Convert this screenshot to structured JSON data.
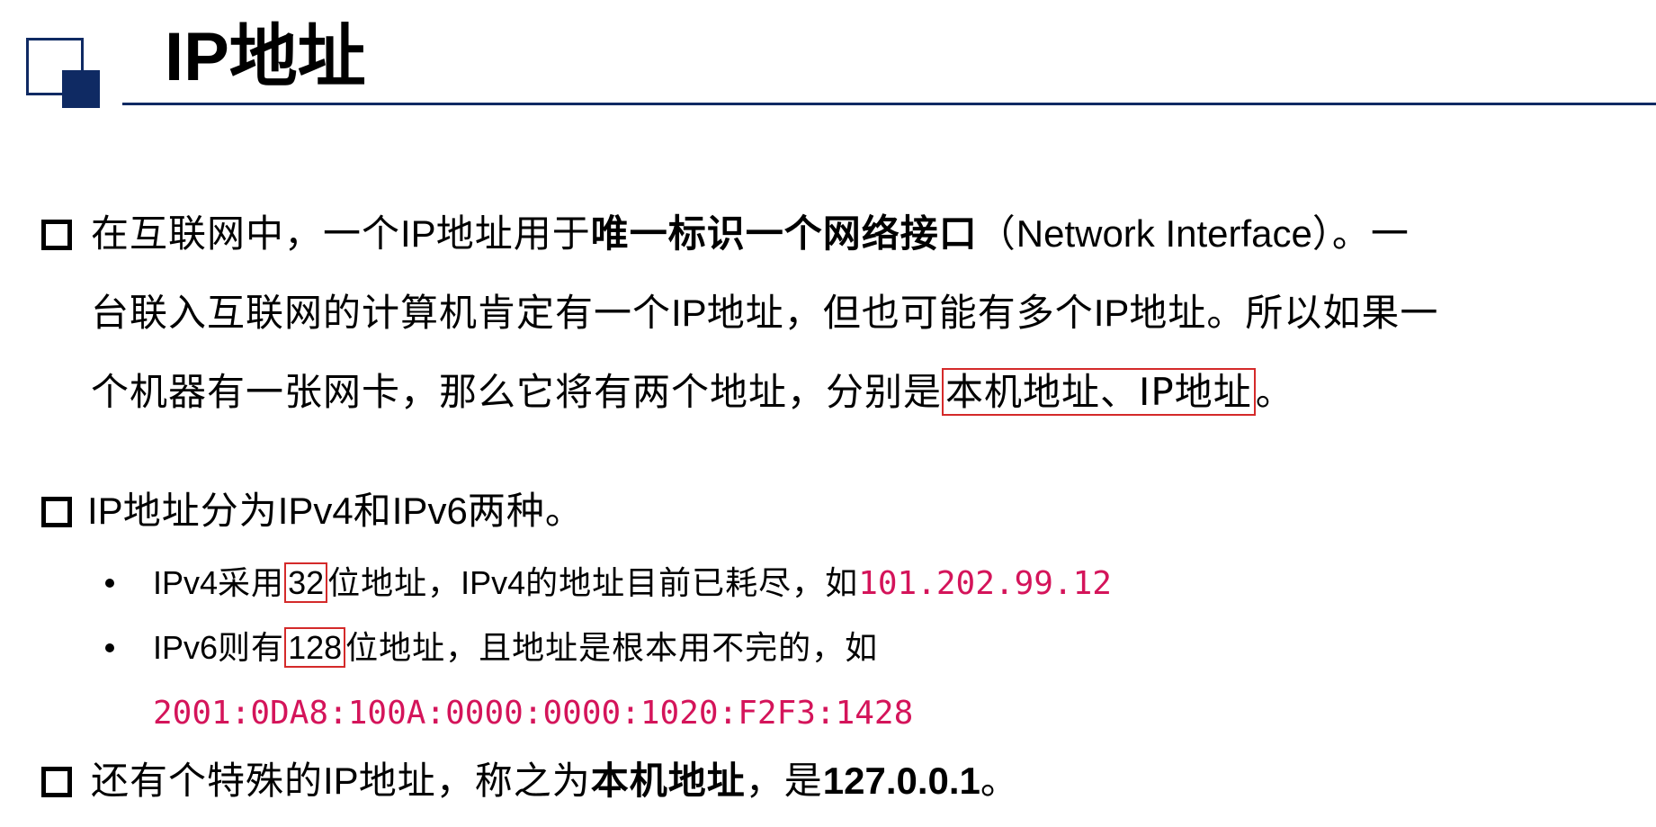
{
  "title": "IP地址",
  "p1": {
    "l1_a": "在互联网中，一个",
    "l1_b": "IP",
    "l1_c": "地址用于",
    "l1_d": "唯一标识一个网络接口",
    "l1_e": "（",
    "l1_f": "Network Interface",
    "l1_g": "）。一",
    "l2_a": "台联入互联网的计算机肯定有一个",
    "l2_b": "IP",
    "l2_c": "地址，但也可能有多个",
    "l2_d": "IP",
    "l2_e": "地址。所以如果一",
    "l3_a": "个机器有一张网卡，那么它将有两个地址，分别是",
    "l3_box": "本机地址、IP地址",
    "l3_end": "。"
  },
  "p2": {
    "a": "IP",
    "b": "地址分为",
    "c": "IPv4",
    "d": "和",
    "e": "IPv6",
    "f": "两种。"
  },
  "ipv4": {
    "a": "IPv4",
    "b": "采用",
    "bits": "32",
    "c": "位地址，",
    "d": "IPv4",
    "e": "的地址目前已耗尽，如",
    "example": "101.202.99.12"
  },
  "ipv6": {
    "a": "IPv6",
    "b": "则有",
    "bits": "128",
    "c": "位地址，且地址是根本用不完的，如",
    "example": "2001:0DA8:100A:0000:0000:1020:F2F3:1428"
  },
  "p3": {
    "a": "还有个特殊的",
    "b": "IP",
    "c": "地址，称之为",
    "d": "本机地址",
    "e": "，是",
    "f": "127.0.0.1",
    "g": "。"
  },
  "colors": {
    "accent": "#0f2a63",
    "highlight_border": "#d42a2a",
    "code": "#d4145a"
  }
}
